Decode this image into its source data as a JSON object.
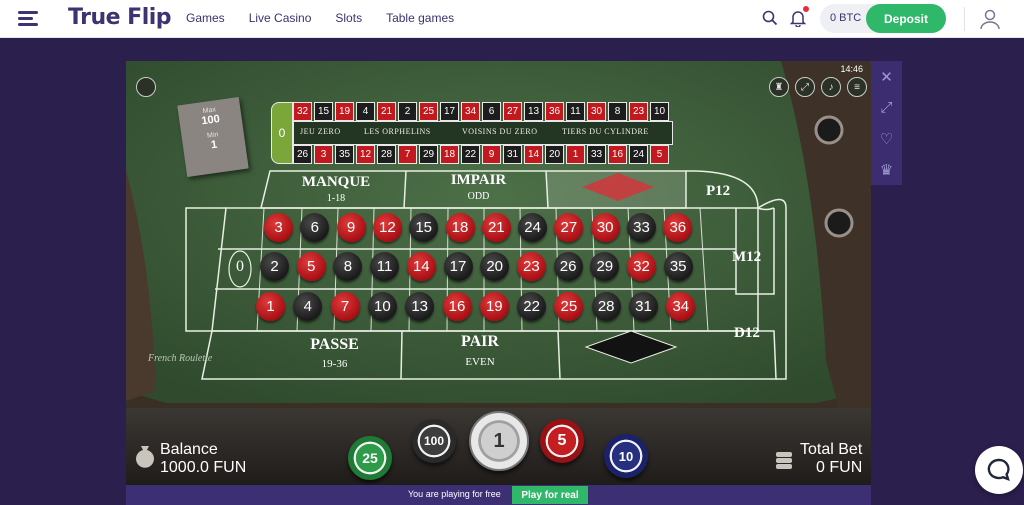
{
  "header": {
    "logo": "True Flip",
    "nav": [
      "Games",
      "Live Casino",
      "Slots",
      "Table games"
    ],
    "balance": "0 BTC",
    "deposit_label": "Deposit"
  },
  "game": {
    "clock": "14:46",
    "limits": {
      "max_label": "Max",
      "max_value": "100",
      "min_label": "Min",
      "min_value": "1"
    },
    "racetrack": {
      "zero": "0",
      "top_row": [
        "32",
        "15",
        "19",
        "4",
        "21",
        "2",
        "25",
        "17",
        "34",
        "6",
        "27",
        "13",
        "36",
        "11",
        "30",
        "8",
        "23",
        "10"
      ],
      "bottom_row": [
        "26",
        "3",
        "35",
        "12",
        "28",
        "7",
        "29",
        "18",
        "22",
        "9",
        "31",
        "14",
        "20",
        "1",
        "33",
        "16",
        "24",
        "5"
      ],
      "sections": [
        "JEU ZERO",
        "LES ORPHELINS",
        "VOISINS DU ZERO",
        "TIERS DU CYLINDRE"
      ]
    },
    "table": {
      "manque": "MANQUE",
      "manque_range": "1-18",
      "impair": "IMPAIR",
      "impair_en": "ODD",
      "passe": "PASSE",
      "passe_range": "19-36",
      "pair": "PAIR",
      "pair_en": "EVEN",
      "zero": "0",
      "dozens": [
        "P12",
        "M12",
        "D12"
      ],
      "row_top": [
        "3",
        "6",
        "9",
        "12",
        "15",
        "18",
        "21",
        "24",
        "27",
        "30",
        "33",
        "36"
      ],
      "row_mid": [
        "2",
        "5",
        "8",
        "11",
        "14",
        "17",
        "20",
        "23",
        "26",
        "29",
        "32",
        "35"
      ],
      "row_bot": [
        "1",
        "4",
        "7",
        "10",
        "13",
        "16",
        "19",
        "22",
        "25",
        "28",
        "31",
        "34"
      ],
      "brand": "French Roulette"
    },
    "balance_label": "Balance",
    "balance_value": "1000.0 FUN",
    "total_bet_label": "Total Bet",
    "total_bet_value": "0 FUN",
    "chips": [
      "25",
      "100",
      "1",
      "5",
      "10"
    ]
  },
  "footer": {
    "free_text": "You are playing for free",
    "play_real": "Play for real"
  }
}
